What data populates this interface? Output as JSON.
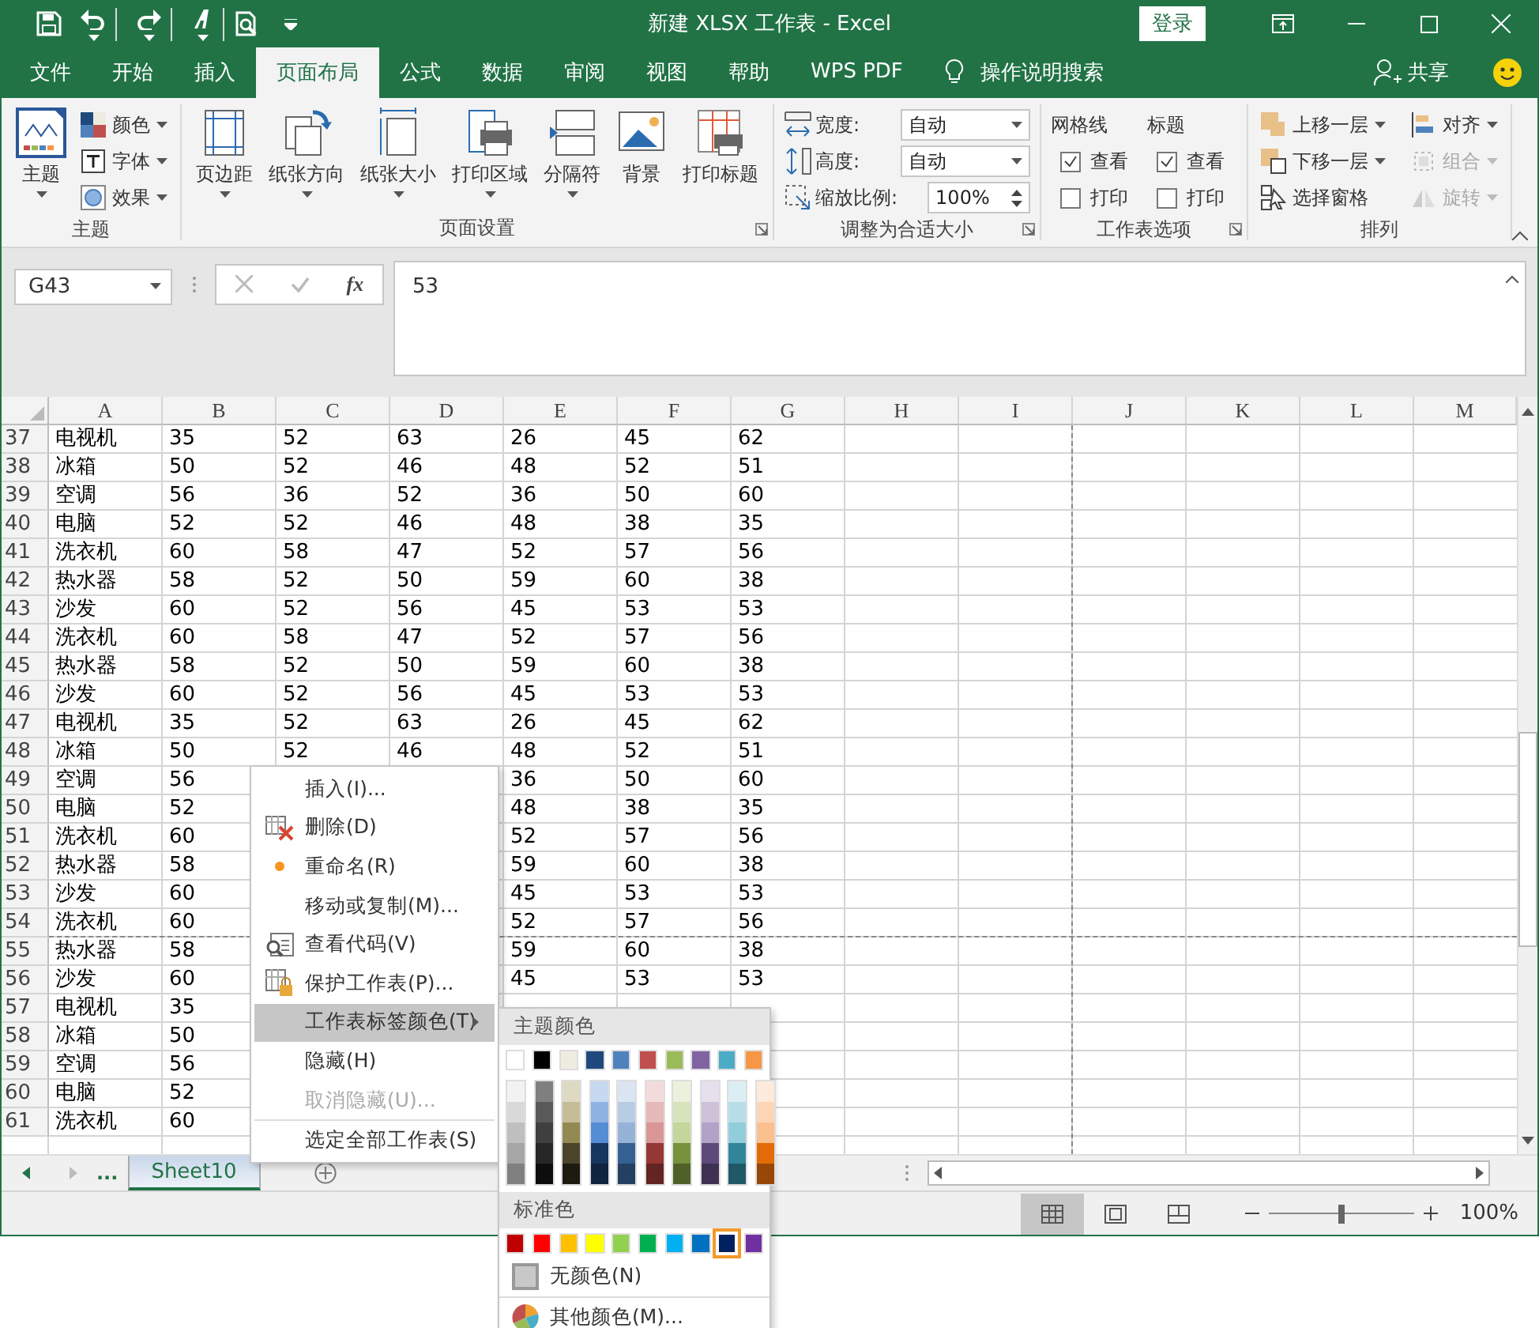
{
  "title_bar": {
    "title": "新建 XLSX 工作表  -  Excel",
    "sign_in": "登录"
  },
  "tabs": [
    {
      "label": "文件",
      "selected": false
    },
    {
      "label": "开始",
      "selected": false
    },
    {
      "label": "插入",
      "selected": false
    },
    {
      "label": "页面布局",
      "selected": true
    },
    {
      "label": "公式",
      "selected": false
    },
    {
      "label": "数据",
      "selected": false
    },
    {
      "label": "审阅",
      "selected": false
    },
    {
      "label": "视图",
      "selected": false
    },
    {
      "label": "帮助",
      "selected": false
    },
    {
      "label": "WPS PDF",
      "selected": false
    }
  ],
  "tell_me": "操作说明搜索",
  "share": "共享",
  "ribbon": {
    "groups": [
      {
        "title": "主题",
        "launcher": false,
        "items": [
          {
            "kind": "large",
            "label": "主题",
            "caret": true
          },
          {
            "kind": "small",
            "label": "颜色",
            "caret": true,
            "disabled": false
          },
          {
            "kind": "small",
            "label": "字体",
            "caret": true,
            "disabled": false
          },
          {
            "kind": "small",
            "label": "效果",
            "caret": true,
            "disabled": false
          }
        ]
      },
      {
        "title": "页面设置",
        "launcher": true,
        "items": [
          {
            "kind": "large",
            "label": "页边距",
            "caret": true
          },
          {
            "kind": "large",
            "label": "纸张方向",
            "caret": true
          },
          {
            "kind": "large",
            "label": "纸张大小",
            "caret": true
          },
          {
            "kind": "large",
            "label": "打印区域",
            "caret": true
          },
          {
            "kind": "large",
            "label": "分隔符",
            "caret": true
          },
          {
            "kind": "large",
            "label": "背景",
            "caret": false
          },
          {
            "kind": "large",
            "label": "打印标题",
            "caret": false
          }
        ]
      },
      {
        "title": "调整为合适大小",
        "launcher": true,
        "items": [
          {
            "kind": "dropdown",
            "label": "宽度:",
            "value": "自动"
          },
          {
            "kind": "dropdown",
            "label": "高度:",
            "value": "自动"
          },
          {
            "kind": "spinner",
            "label": "缩放比例:",
            "value": "100%"
          }
        ]
      },
      {
        "title": "工作表选项",
        "launcher": true,
        "items": [
          {
            "kind": "checks",
            "label": "网格线",
            "options": [
              {
                "label": "查看",
                "checked": true
              },
              {
                "label": "打印",
                "checked": false
              }
            ]
          },
          {
            "kind": "checks",
            "label": "标题",
            "options": [
              {
                "label": "查看",
                "checked": true
              },
              {
                "label": "打印",
                "checked": false
              }
            ]
          }
        ]
      },
      {
        "title": "排列",
        "launcher": false,
        "items": [
          {
            "kind": "small",
            "label": "上移一层",
            "caret": true,
            "disabled": false
          },
          {
            "kind": "small",
            "label": "下移一层",
            "caret": true,
            "disabled": false
          },
          {
            "kind": "small",
            "label": "选择窗格",
            "caret": false,
            "disabled": false
          },
          {
            "kind": "small",
            "label": "对齐",
            "caret": true,
            "disabled": false
          },
          {
            "kind": "small",
            "label": "组合",
            "caret": true,
            "disabled": true
          },
          {
            "kind": "small",
            "label": "旋转",
            "caret": true,
            "disabled": true
          }
        ]
      }
    ]
  },
  "formula_bar": {
    "name_box": "G43",
    "fx": "fx",
    "value": "53"
  },
  "sheet": {
    "columns": [
      {
        "label": "A",
        "page_break_after": false
      },
      {
        "label": "B",
        "page_break_after": false
      },
      {
        "label": "C",
        "page_break_after": false
      },
      {
        "label": "D",
        "page_break_after": false
      },
      {
        "label": "E",
        "page_break_after": false
      },
      {
        "label": "F",
        "page_break_after": false
      },
      {
        "label": "G",
        "page_break_after": false
      },
      {
        "label": "H",
        "page_break_after": false
      },
      {
        "label": "I",
        "page_break_after": true
      },
      {
        "label": "J",
        "page_break_after": false
      },
      {
        "label": "K",
        "page_break_after": false
      },
      {
        "label": "L",
        "page_break_after": false
      },
      {
        "label": "M",
        "page_break_after": false
      }
    ],
    "rows": [
      {
        "header": "37",
        "page_break_after": false,
        "cells": [
          "电视机",
          "35",
          "52",
          "63",
          "26",
          "45",
          "62"
        ]
      },
      {
        "header": "38",
        "page_break_after": false,
        "cells": [
          "冰箱",
          "50",
          "52",
          "46",
          "48",
          "52",
          "51"
        ]
      },
      {
        "header": "39",
        "page_break_after": false,
        "cells": [
          "空调",
          "56",
          "36",
          "52",
          "36",
          "50",
          "60"
        ]
      },
      {
        "header": "40",
        "page_break_after": false,
        "cells": [
          "电脑",
          "52",
          "52",
          "46",
          "48",
          "38",
          "35"
        ]
      },
      {
        "header": "41",
        "page_break_after": false,
        "cells": [
          "洗衣机",
          "60",
          "58",
          "47",
          "52",
          "57",
          "56"
        ]
      },
      {
        "header": "42",
        "page_break_after": false,
        "cells": [
          "热水器",
          "58",
          "52",
          "50",
          "59",
          "60",
          "38"
        ]
      },
      {
        "header": "43",
        "page_break_after": false,
        "cells": [
          "沙发",
          "60",
          "52",
          "56",
          "45",
          "53",
          "53"
        ]
      },
      {
        "header": "44",
        "page_break_after": false,
        "cells": [
          "洗衣机",
          "60",
          "58",
          "47",
          "52",
          "57",
          "56"
        ]
      },
      {
        "header": "45",
        "page_break_after": false,
        "cells": [
          "热水器",
          "58",
          "52",
          "50",
          "59",
          "60",
          "38"
        ]
      },
      {
        "header": "46",
        "page_break_after": false,
        "cells": [
          "沙发",
          "60",
          "52",
          "56",
          "45",
          "53",
          "53"
        ]
      },
      {
        "header": "47",
        "page_break_after": false,
        "cells": [
          "电视机",
          "35",
          "52",
          "63",
          "26",
          "45",
          "62"
        ]
      },
      {
        "header": "48",
        "page_break_after": false,
        "cells": [
          "冰箱",
          "50",
          "52",
          "46",
          "48",
          "52",
          "51"
        ]
      },
      {
        "header": "49",
        "page_break_after": false,
        "cells": [
          "空调",
          "56",
          null,
          null,
          "36",
          "50",
          "60"
        ]
      },
      {
        "header": "50",
        "page_break_after": false,
        "cells": [
          "电脑",
          "52",
          null,
          null,
          "48",
          "38",
          "35"
        ]
      },
      {
        "header": "51",
        "page_break_after": false,
        "cells": [
          "洗衣机",
          "60",
          null,
          null,
          "52",
          "57",
          "56"
        ]
      },
      {
        "header": "52",
        "page_break_after": false,
        "cells": [
          "热水器",
          "58",
          null,
          null,
          "59",
          "60",
          "38"
        ]
      },
      {
        "header": "53",
        "page_break_after": false,
        "cells": [
          "沙发",
          "60",
          null,
          null,
          "45",
          "53",
          "53"
        ]
      },
      {
        "header": "54",
        "page_break_after": true,
        "cells": [
          "洗衣机",
          "60",
          null,
          null,
          "52",
          "57",
          "56"
        ]
      },
      {
        "header": "55",
        "page_break_after": false,
        "cells": [
          "热水器",
          "58",
          null,
          null,
          "59",
          "60",
          "38"
        ]
      },
      {
        "header": "56",
        "page_break_after": false,
        "cells": [
          "沙发",
          "60",
          null,
          null,
          "45",
          "53",
          "53"
        ]
      },
      {
        "header": "57",
        "page_break_after": false,
        "cells": [
          "电视机",
          "35",
          null,
          null,
          null,
          null,
          null
        ]
      },
      {
        "header": "58",
        "page_break_after": false,
        "cells": [
          "冰箱",
          "50",
          null,
          null,
          null,
          null,
          null
        ]
      },
      {
        "header": "59",
        "page_break_after": false,
        "cells": [
          "空调",
          "56",
          null,
          null,
          null,
          null,
          null
        ]
      },
      {
        "header": "60",
        "page_break_after": false,
        "cells": [
          "电脑",
          "52",
          null,
          null,
          null,
          null,
          null
        ]
      },
      {
        "header": "61",
        "page_break_after": false,
        "cells": [
          "洗衣机",
          "60",
          null,
          null,
          null,
          null,
          null
        ]
      }
    ]
  },
  "sheet_tabs": {
    "ellipsis": "...",
    "tabs": [
      {
        "label": "Sheet10",
        "selected": true
      }
    ]
  },
  "status_bar": {
    "views": [
      {
        "selected": true
      },
      {
        "selected": false
      },
      {
        "selected": false
      }
    ],
    "zoom": {
      "level": 0.5,
      "reading": "100%"
    }
  },
  "context_menu": {
    "items": [
      {
        "label": "插入(I)...",
        "disabled": false,
        "highlighted": false,
        "submenu": false,
        "divider_above": false
      },
      {
        "label": "删除(D)",
        "disabled": false,
        "highlighted": false,
        "submenu": false,
        "divider_above": false
      },
      {
        "label": "重命名(R)",
        "disabled": false,
        "highlighted": false,
        "submenu": false,
        "divider_above": false
      },
      {
        "label": "移动或复制(M)...",
        "disabled": false,
        "highlighted": false,
        "submenu": false,
        "divider_above": false
      },
      {
        "label": "查看代码(V)",
        "disabled": false,
        "highlighted": false,
        "submenu": false,
        "divider_above": false
      },
      {
        "label": "保护工作表(P)...",
        "disabled": false,
        "highlighted": false,
        "submenu": false,
        "divider_above": false
      },
      {
        "label": "工作表标签颜色(T)",
        "disabled": false,
        "highlighted": true,
        "submenu": true,
        "divider_above": false
      },
      {
        "label": "隐藏(H)",
        "disabled": false,
        "highlighted": false,
        "submenu": false,
        "divider_above": false
      },
      {
        "label": "取消隐藏(U)...",
        "disabled": true,
        "highlighted": false,
        "submenu": false,
        "divider_above": false
      },
      {
        "label": "选定全部工作表(S)",
        "disabled": false,
        "highlighted": false,
        "submenu": false,
        "divider_above": true
      }
    ]
  },
  "palette": {
    "theme_title": "主题颜色",
    "theme_colors": [
      {
        "color": "#ffffff",
        "shades": [
          {
            "color": "#f2f2f2"
          },
          {
            "color": "#d9d9d9"
          },
          {
            "color": "#bfbfbf"
          },
          {
            "color": "#a6a6a6"
          },
          {
            "color": "#808080"
          }
        ]
      },
      {
        "color": "#000000",
        "shades": [
          {
            "color": "#7f7f7f"
          },
          {
            "color": "#595959"
          },
          {
            "color": "#3f3f3f"
          },
          {
            "color": "#262626"
          },
          {
            "color": "#0d0d0d"
          }
        ]
      },
      {
        "color": "#eeece1",
        "shades": [
          {
            "color": "#ddd9c3"
          },
          {
            "color": "#c4bd97"
          },
          {
            "color": "#938953"
          },
          {
            "color": "#4a452a"
          },
          {
            "color": "#1d1b10"
          }
        ]
      },
      {
        "color": "#1f497d",
        "shades": [
          {
            "color": "#c6d9f0"
          },
          {
            "color": "#8db3e2"
          },
          {
            "color": "#548dd4"
          },
          {
            "color": "#17365d"
          },
          {
            "color": "#0f243e"
          }
        ]
      },
      {
        "color": "#4f81bd",
        "shades": [
          {
            "color": "#dbe5f1"
          },
          {
            "color": "#b8cce4"
          },
          {
            "color": "#95b3d7"
          },
          {
            "color": "#366092"
          },
          {
            "color": "#244061"
          }
        ]
      },
      {
        "color": "#c0504d",
        "shades": [
          {
            "color": "#f2dcdb"
          },
          {
            "color": "#e5b9b7"
          },
          {
            "color": "#d99694"
          },
          {
            "color": "#953734"
          },
          {
            "color": "#632423"
          }
        ]
      },
      {
        "color": "#9bbb59",
        "shades": [
          {
            "color": "#ebf1dd"
          },
          {
            "color": "#d7e3bc"
          },
          {
            "color": "#c3d69b"
          },
          {
            "color": "#76923c"
          },
          {
            "color": "#4f6128"
          }
        ]
      },
      {
        "color": "#8064a2",
        "shades": [
          {
            "color": "#e5e0ec"
          },
          {
            "color": "#ccc1d9"
          },
          {
            "color": "#b2a2c7"
          },
          {
            "color": "#5f497a"
          },
          {
            "color": "#3f3151"
          }
        ]
      },
      {
        "color": "#4bacc6",
        "shades": [
          {
            "color": "#dbeef3"
          },
          {
            "color": "#b7dde8"
          },
          {
            "color": "#92cddc"
          },
          {
            "color": "#31859b"
          },
          {
            "color": "#205867"
          }
        ]
      },
      {
        "color": "#f79646",
        "shades": [
          {
            "color": "#fdeada"
          },
          {
            "color": "#fbd5b5"
          },
          {
            "color": "#fac08f"
          },
          {
            "color": "#e36c09"
          },
          {
            "color": "#974806"
          }
        ]
      }
    ],
    "standard_title": "标准色",
    "standard_colors": [
      {
        "color": "#c00000",
        "selected": false
      },
      {
        "color": "#ff0000",
        "selected": false
      },
      {
        "color": "#ffc000",
        "selected": false
      },
      {
        "color": "#ffff00",
        "selected": false
      },
      {
        "color": "#92d050",
        "selected": false
      },
      {
        "color": "#00b050",
        "selected": false
      },
      {
        "color": "#00b0f0",
        "selected": false
      },
      {
        "color": "#0070c0",
        "selected": false
      },
      {
        "color": "#002060",
        "selected": true
      },
      {
        "color": "#7030a0",
        "selected": false
      }
    ],
    "no_color": "无颜色(N)",
    "more_colors": "其他颜色(M)..."
  }
}
